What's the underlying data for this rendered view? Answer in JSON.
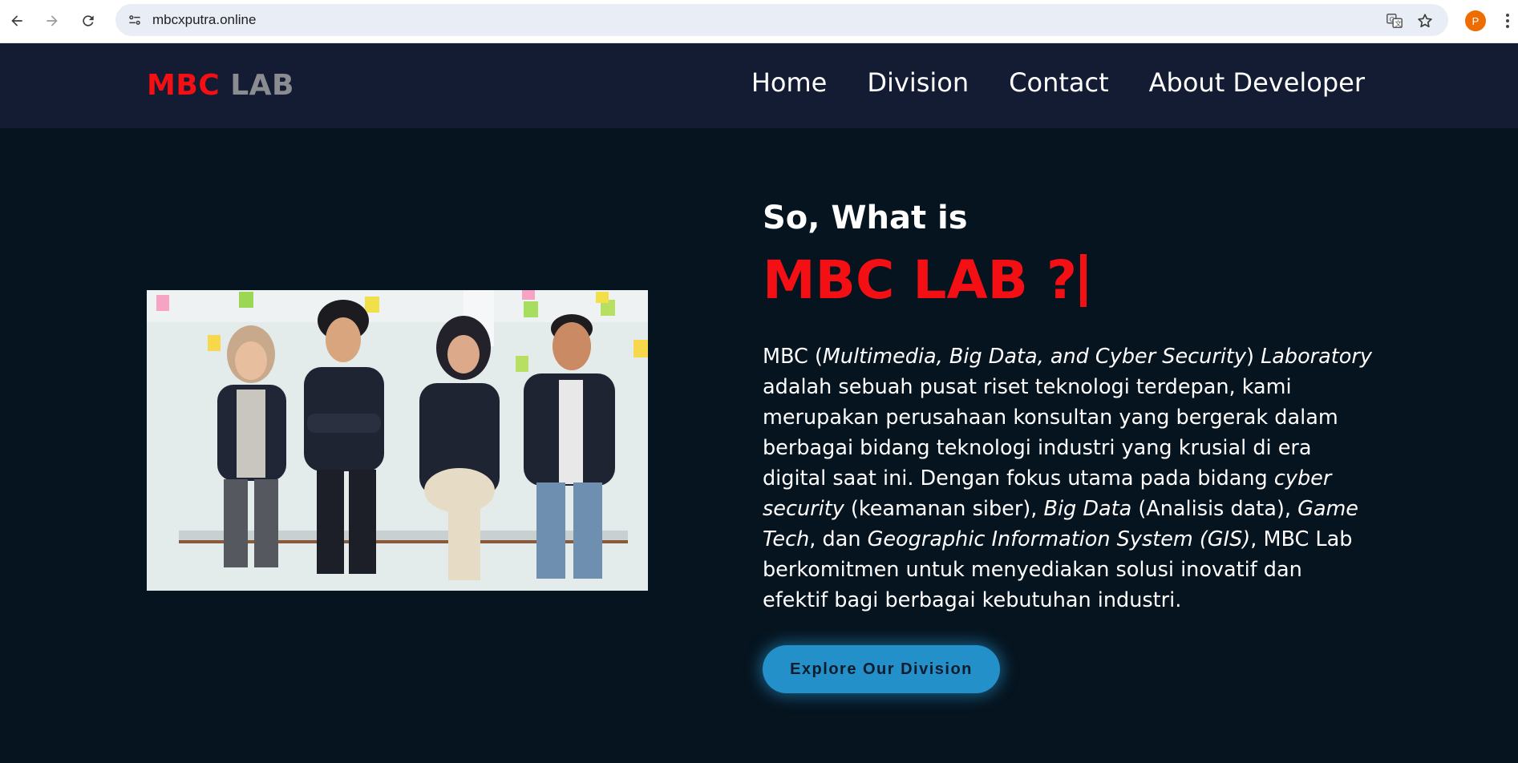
{
  "browser": {
    "url": "mbcxputra.online",
    "profile_initial": "P"
  },
  "site": {
    "logo": {
      "primary": "MBC",
      "secondary": "LAB"
    },
    "nav": [
      {
        "label": "Home"
      },
      {
        "label": "Division"
      },
      {
        "label": "Contact"
      },
      {
        "label": "About Developer"
      }
    ]
  },
  "hero": {
    "subtitle": "So, What is",
    "title": "MBC LAB ?",
    "description": [
      {
        "text": "MBC (",
        "italic": false
      },
      {
        "text": "Multimedia, Big Data, and Cyber Security",
        "italic": true
      },
      {
        "text": ") ",
        "italic": false
      },
      {
        "text": "Laboratory",
        "italic": true
      },
      {
        "text": " adalah sebuah pusat riset teknologi terdepan, kami merupakan perusahaan konsultan yang bergerak dalam berbagai bidang teknologi industri yang krusial di era digital saat ini. Dengan fokus utama pada bidang ",
        "italic": false
      },
      {
        "text": "cyber security",
        "italic": true
      },
      {
        "text": " (keamanan siber), ",
        "italic": false
      },
      {
        "text": "Big Data",
        "italic": true
      },
      {
        "text": " (Analisis data), ",
        "italic": false
      },
      {
        "text": "Game Tech",
        "italic": true
      },
      {
        "text": ", dan ",
        "italic": false
      },
      {
        "text": "Geographic Information System (GIS)",
        "italic": true
      },
      {
        "text": ", MBC Lab berkomitmen untuk menyediakan solusi inovatif dan efektif bagi berbagai kebutuhan industri.",
        "italic": false
      }
    ],
    "cta_label": "Explore Our Division"
  },
  "colors": {
    "page_bg": "#06141f",
    "header_bg": "#131c33",
    "accent_red": "#f40f14",
    "logo_gray": "#8a8c92",
    "cta_blue": "#2390c9"
  },
  "icons": [
    "back-arrow-icon",
    "forward-arrow-icon",
    "reload-icon",
    "site-info-icon",
    "translate-icon",
    "star-icon",
    "more-menu-icon"
  ]
}
